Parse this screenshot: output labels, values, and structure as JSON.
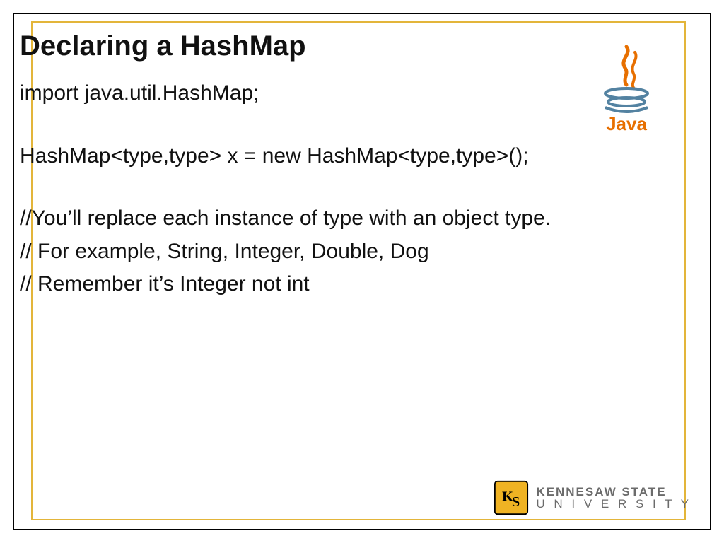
{
  "title": "Declaring a HashMap",
  "body": {
    "line1": "import java.util.HashMap;",
    "line2": "HashMap<type,type> x = new HashMap<type,type>();",
    "line3": "//You’ll replace each instance of type with an object type.",
    "line4": "// For example, String, Integer, Double, Dog",
    "line5": "// Remember it’s Integer not int"
  },
  "logos": {
    "java_name": "java-logo",
    "java_wordmark": "Java",
    "ksu_line1": "KENNESAW STATE",
    "ksu_line2": "U N I V E R S I T Y"
  },
  "colors": {
    "outer_border": "#000000",
    "inner_border": "#e3b53a",
    "java_orange": "#e76f00",
    "java_blue": "#5382a1",
    "ksu_gold": "#f0b323",
    "ksu_gray": "#6b6b6b"
  }
}
